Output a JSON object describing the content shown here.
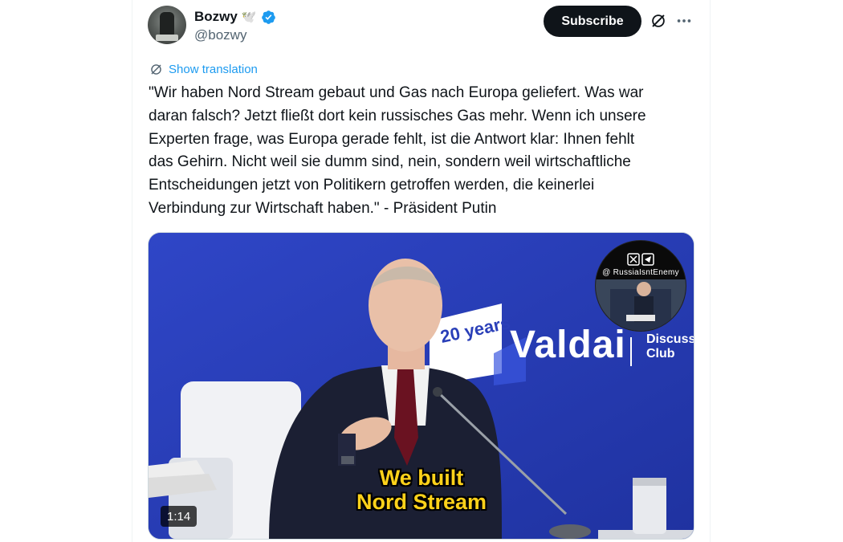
{
  "author": {
    "display_name": "Bozwy",
    "handle": "@bozwy",
    "badge_emoji": "🕊️",
    "verified": true
  },
  "actions": {
    "subscribe_label": "Subscribe"
  },
  "translation": {
    "label": "Show translation"
  },
  "tweet": {
    "text": "\"Wir haben Nord Stream gebaut und Gas nach Europa geliefert. Was war\ndaran falsch? Jetzt fließt dort kein russisches Gas mehr. Wenn ich unsere\nExperten frage, was Europa gerade fehlt, ist die Antwort klar: Ihnen fehlt\ndas Gehirn. Nicht weil sie dumm sind, nein, sondern weil wirtschaftliche\nEntscheidungen jetzt von Politikern getroffen werden, die keinerlei\nVerbindung zur Wirtschaft haben.\" - Präsident Putin"
  },
  "video": {
    "duration": "1:14",
    "subtitle_line1": "We built",
    "subtitle_line2": "Nord Stream",
    "backdrop_brand": "Valdai",
    "backdrop_sub": "Discussi\nClub",
    "backdrop_years": "20 years",
    "watermark_handle": "@ RussiaIsntEnemy"
  },
  "colors": {
    "accent": "#1d9bf0",
    "subscribe_bg": "#0f1419",
    "subtitle": "#ffd21a",
    "backdrop": "#2a3fb8"
  }
}
